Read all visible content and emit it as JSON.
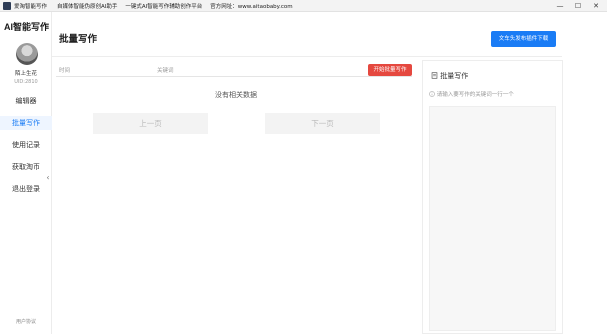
{
  "window": {
    "title": "爱淘智能写作",
    "menu": [
      "自媒体智能伪原创AI助手",
      "一键式AI智能写作辅助创作平台",
      "官方网址：www.aitaobaby.com"
    ],
    "controls": {
      "minimize": "—",
      "maximize": "☐",
      "close": "✕"
    }
  },
  "sidebar": {
    "logo": "AI智能写作",
    "user": {
      "name": "陌上生花",
      "uid": "UID:2810"
    },
    "items": [
      {
        "label": "编辑器",
        "active": false
      },
      {
        "label": "批量写作",
        "active": true
      },
      {
        "label": "使用记录",
        "active": false
      },
      {
        "label": "获取淘币",
        "active": false
      },
      {
        "label": "退出登录",
        "active": false
      }
    ],
    "collapse": "‹",
    "agreement": "用户协议"
  },
  "main": {
    "title": "批量写作",
    "download_button": "文车头发布插件下载",
    "filter": {
      "time_placeholder": "时间",
      "keyword_placeholder": "关键词",
      "start_button": "开始批量写作"
    },
    "empty_text": "没有相关数据",
    "pager": {
      "prev": "上一页",
      "next": "下一页"
    }
  },
  "right_panel": {
    "title": "批量写作",
    "title_icon": "document-icon",
    "hint": "请输入要写作的关键词一行一个",
    "hint_icon": "info-icon"
  },
  "colors": {
    "accent": "#1a7cf5",
    "danger": "#e5483f"
  }
}
